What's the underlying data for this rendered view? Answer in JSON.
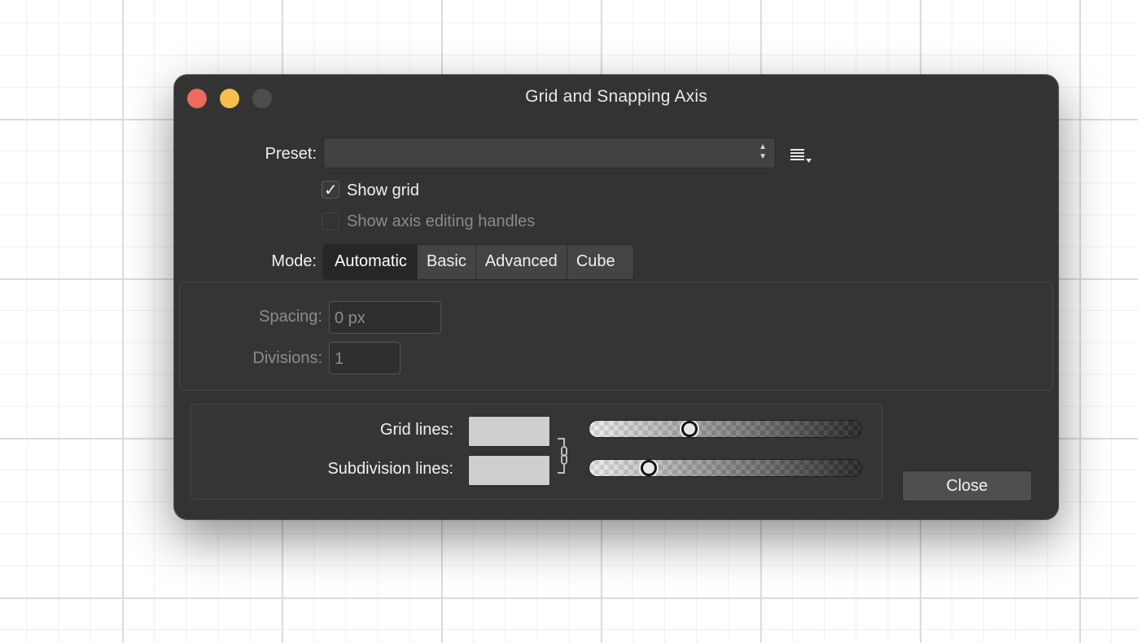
{
  "window": {
    "title": "Grid and Snapping Axis"
  },
  "preset": {
    "label": "Preset:",
    "value": ""
  },
  "options": {
    "show_grid": {
      "label": "Show grid",
      "checked": true
    },
    "show_axis_handles": {
      "label": "Show axis editing handles",
      "checked": false,
      "enabled": false
    }
  },
  "mode": {
    "label": "Mode:",
    "tabs": [
      "Automatic",
      "Basic",
      "Advanced",
      "Cube"
    ],
    "selected": "Automatic"
  },
  "spacing": {
    "label": "Spacing:",
    "value": "0 px"
  },
  "divisions": {
    "label": "Divisions:",
    "value": "1"
  },
  "lines": {
    "grid": {
      "label": "Grid lines:",
      "color": "#cfcfcf",
      "opacity": 0.36
    },
    "subdivision": {
      "label": "Subdivision lines:",
      "color": "#cfcfcf",
      "opacity": 0.2
    }
  },
  "close_button": {
    "label": "Close"
  },
  "colors": {
    "window_bg": "#333333",
    "close_light": "#ed6a5e",
    "minimize_light": "#f5bf4f",
    "zoom_light_disabled": "#4d4d4d"
  }
}
